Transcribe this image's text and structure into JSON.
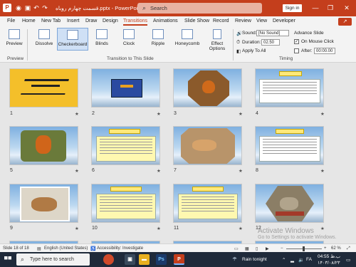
{
  "titlebar": {
    "app_icon": "P",
    "doc_title": "قسمت چهارم روباه.pptx  -  PowerPoint",
    "search_placeholder": "Search",
    "signin_label": "Sign in",
    "controls": {
      "minimize": "—",
      "restore": "❐",
      "close": "✕"
    }
  },
  "menu": {
    "items": [
      "File",
      "Home",
      "New Tab",
      "Insert",
      "Draw",
      "Design",
      "Transitions",
      "Animations",
      "Slide Show",
      "Record",
      "Review",
      "View",
      "Developer"
    ],
    "active": "Transitions",
    "share_icon": "↗"
  },
  "ribbon": {
    "preview_label": "Preview",
    "preview_group": "Preview",
    "transitions": [
      "Dissolve",
      "Checkerboard",
      "Blinds",
      "Clock",
      "Ripple",
      "Honeycomb"
    ],
    "selected_transition": "Checkerboard",
    "effect_options": "Effect Options",
    "transition_group": "Transition to This Slide",
    "sound_label": "Sound:",
    "sound_value": "[No Sound]",
    "duration_label": "Duration:",
    "duration_value": "02.50",
    "apply_all": "Apply To All",
    "advance_label": "Advance Slide",
    "on_mouse_click": "On Mouse Click",
    "after_label": "After:",
    "after_value": "00:00.00",
    "timing_group": "Timing"
  },
  "slides": [
    {
      "number": "1"
    },
    {
      "number": "2"
    },
    {
      "number": "3"
    },
    {
      "number": "4"
    },
    {
      "number": "5"
    },
    {
      "number": "6"
    },
    {
      "number": "7"
    },
    {
      "number": "8"
    },
    {
      "number": "9"
    },
    {
      "number": "10"
    },
    {
      "number": "11"
    },
    {
      "number": "12"
    }
  ],
  "watermark": {
    "line1": "Activate Windows",
    "line2": "Go to Settings to activate Windows."
  },
  "status": {
    "slide_count": "Slide 18 of 18",
    "language": "English (United States)",
    "accessibility": "Accessibility: Investigate",
    "zoom": "62 %"
  },
  "taskbar": {
    "search_placeholder": "Type here to search",
    "weather": "Rain tonight",
    "time": "04:55 ب.ظ",
    "date": "۱۴۰۳/۰۸/۲۳",
    "lang": "FA"
  },
  "colors": {
    "accent": "#c43e1c",
    "ribbon_bg": "#f3f3f3",
    "slide_sky": "#8fbce8"
  }
}
